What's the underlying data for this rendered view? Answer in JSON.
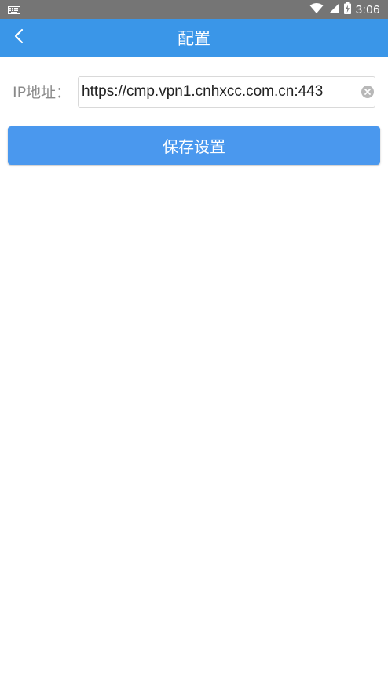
{
  "status_bar": {
    "time": "3:06",
    "icons": [
      "keyboard-icon",
      "wifi-icon",
      "cellular-signal-icon",
      "battery-charging-icon"
    ]
  },
  "app_bar": {
    "title": "配置",
    "back_icon": "chevron-left-icon"
  },
  "form": {
    "ip_label": "IP地址：",
    "ip_value": "https://cmp.vpn1.cnhxcc.com.cn:443",
    "clear_icon": "clear-circle-icon"
  },
  "save_button_label": "保存设置",
  "colors": {
    "status_bar": "#757575",
    "app_bar": "#3A96E8",
    "save_button": "#4A98EE",
    "label_text": "#8A8A8A"
  }
}
